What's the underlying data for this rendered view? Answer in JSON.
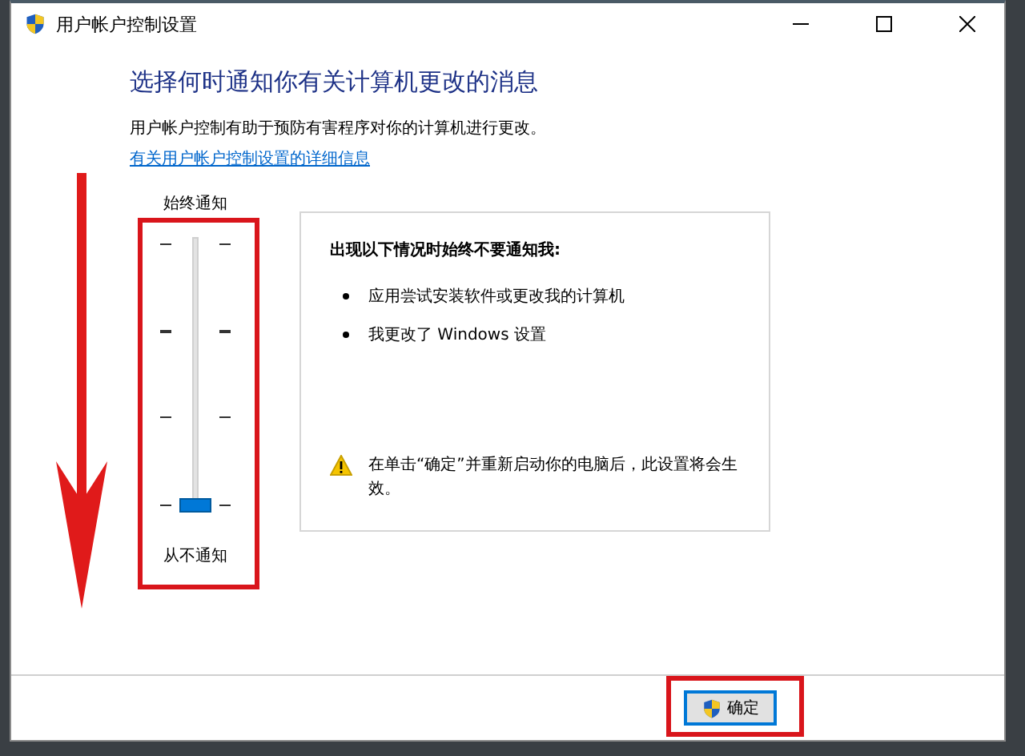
{
  "window": {
    "title": "用户帐户控制设置"
  },
  "heading": "选择何时通知你有关计算机更改的消息",
  "description": "用户帐户控制有助于预防有害程序对你的计算机进行更改。",
  "link": "有关用户帐户控制设置的详细信息",
  "slider": {
    "top_label": "始终通知",
    "bottom_label": "从不通知",
    "level": 0
  },
  "info_panel": {
    "title": "出现以下情况时始终不要通知我:",
    "bullets": [
      "应用尝试安装软件或更改我的计算机",
      "我更改了 Windows 设置"
    ],
    "warning": "在单击“确定”并重新启动你的电脑后，此设置将会生效。"
  },
  "buttons": [
    "确定"
  ]
}
